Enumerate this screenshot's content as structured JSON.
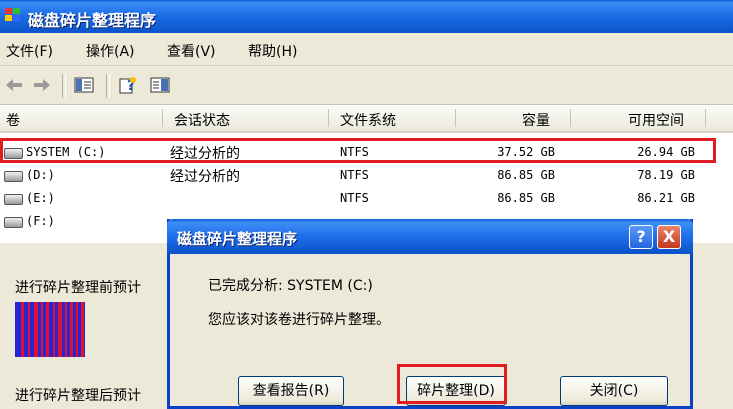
{
  "window": {
    "title": "磁盘碎片整理程序"
  },
  "menu": [
    {
      "label": "文件(F)"
    },
    {
      "label": "操作(A)"
    },
    {
      "label": "查看(V)"
    },
    {
      "label": "帮助(H)"
    }
  ],
  "toolbar": {
    "icons": [
      "back-arrow-icon",
      "forward-arrow-icon",
      "console-tree-icon",
      "help-icon",
      "details-pane-icon"
    ]
  },
  "table": {
    "headers": [
      "卷",
      "会话状态",
      "文件系统",
      "容量",
      "可用空间"
    ],
    "rows": [
      {
        "volume": "SYSTEM (C:)",
        "status": "经过分析的",
        "fs": "NTFS",
        "capacity": "37.52 GB",
        "free": "26.94 GB"
      },
      {
        "volume": "(D:)",
        "status": "经过分析的",
        "fs": "NTFS",
        "capacity": "86.85 GB",
        "free": "78.19 GB"
      },
      {
        "volume": "(E:)",
        "status": "",
        "fs": "NTFS",
        "capacity": "86.85 GB",
        "free": "86.21 GB"
      },
      {
        "volume": "(F:)",
        "status": "",
        "fs": "",
        "capacity": "",
        "free": ""
      }
    ]
  },
  "panel": {
    "before_label": "进行碎片整理前预计",
    "after_label": "进行碎片整理后预计"
  },
  "colors": {
    "used": "#2626d8",
    "fragmented": "#e2112b",
    "highlight": "#e31b23"
  },
  "dialog": {
    "title": "磁盘碎片整理程序",
    "help_glyph": "?",
    "close_glyph": "X",
    "line1": "已完成分析: SYSTEM (C:)",
    "line2": "您应该对该卷进行碎片整理。",
    "buttons": [
      "查看报告(R)",
      "碎片整理(D)",
      "关闭(C)"
    ]
  }
}
